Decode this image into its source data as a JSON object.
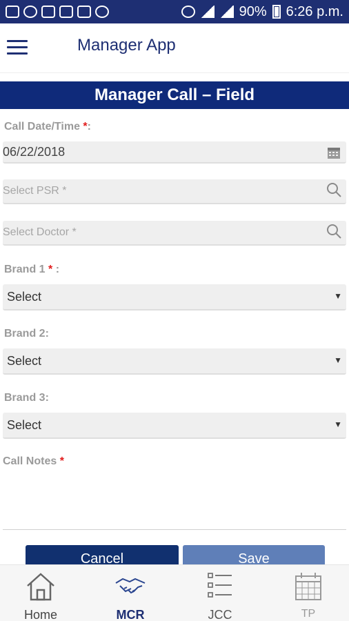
{
  "status_bar": {
    "battery": "90%",
    "time": "6:26 p.m."
  },
  "app": {
    "title": "Manager App"
  },
  "banner": {
    "title": "Manager Call – Field"
  },
  "form": {
    "call_date_label": "Call Date/Time",
    "call_date_value": "06/22/2018",
    "psr_placeholder": "Select PSR *",
    "doctor_placeholder": "Select Doctor *",
    "brand1_label": "Brand 1",
    "brand1_value": "Select",
    "brand2_label": "Brand 2:",
    "brand2_value": "Select",
    "brand3_label": "Brand 3:",
    "brand3_value": "Select",
    "notes_label": "Call Notes",
    "required_mark": "*",
    "colon": ":"
  },
  "buttons": {
    "cancel": "Cancel",
    "save": "Save"
  },
  "bottom_nav": {
    "items": [
      {
        "label": "Home",
        "icon": "home-icon"
      },
      {
        "label": "MCR",
        "icon": "handshake-icon"
      },
      {
        "label": "JCC",
        "icon": "checklist-icon"
      },
      {
        "label": "TP",
        "icon": "calendar-icon"
      }
    ]
  },
  "colors": {
    "primary": "#0f2a7a",
    "required": "#e21b1b",
    "save_button": "#5f7fb8"
  }
}
